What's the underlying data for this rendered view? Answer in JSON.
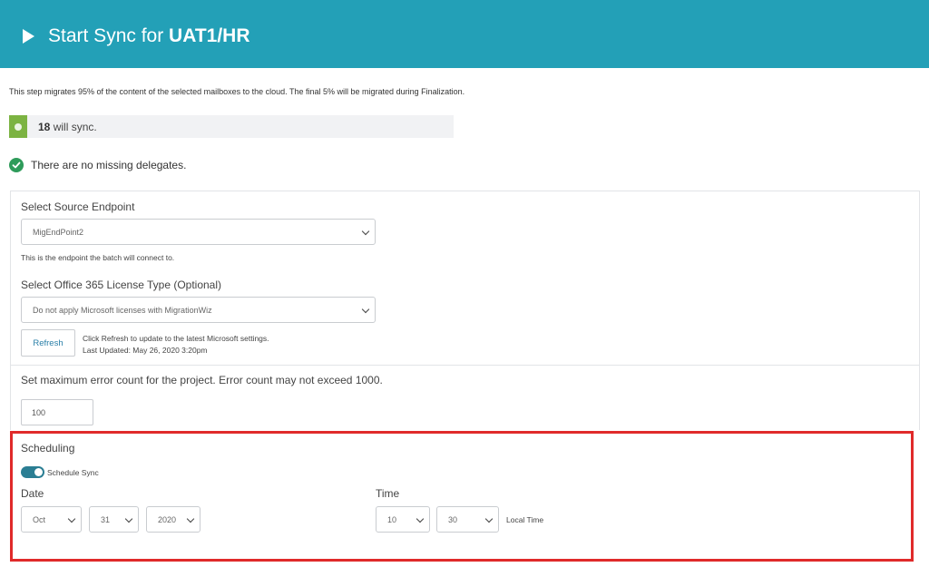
{
  "header": {
    "title_prefix": "Start Sync for ",
    "title_bold": "UAT1/HR",
    "icon": "play-icon",
    "color": "#23a0b7"
  },
  "intro_text": "This step migrates 95% of the content of the selected mailboxes to the cloud. The final 5% will be migrated during Finalization.",
  "sync_status": {
    "count": "18",
    "suffix": " will sync.",
    "color": "#7cb342"
  },
  "delegates": {
    "icon": "check-circle-icon",
    "text": "There are no missing delegates.",
    "color": "#2e9b5a"
  },
  "source_endpoint": {
    "label": "Select Source Endpoint",
    "value": "MigEndPoint2",
    "help": "This is the endpoint the batch will connect to."
  },
  "license_type": {
    "label": "Select Office 365 License Type (Optional)",
    "value": "Do not apply Microsoft licenses with MigrationWiz"
  },
  "refresh": {
    "button_label": "Refresh",
    "help_line1": "Click Refresh to update to the latest Microsoft settings.",
    "help_line2": "Last Updated: May 26, 2020 3:20pm"
  },
  "error_count": {
    "label": "Set maximum error count for the project. Error count may not exceed 1000.",
    "value": "100"
  },
  "scheduling": {
    "title": "Scheduling",
    "toggle_label": "Schedule Sync",
    "toggle_on": true,
    "date_label": "Date",
    "month": "Oct",
    "day": "31",
    "year": "2020",
    "time_label": "Time",
    "hour": "10",
    "minute": "30",
    "time_zone_label": "Local Time",
    "highlight_color": "#e02a2a"
  }
}
